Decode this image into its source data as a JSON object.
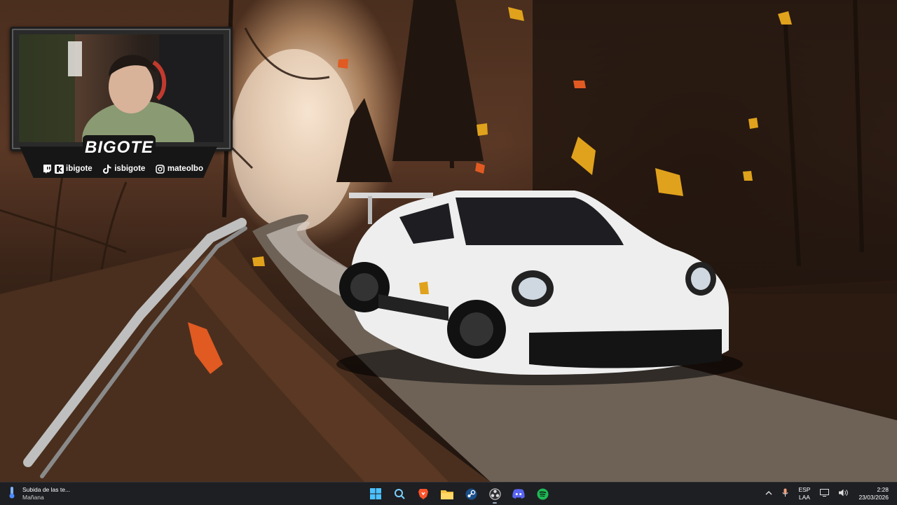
{
  "overlay": {
    "logo": "BIGOTE",
    "socials": [
      {
        "icon": "twitch-icon",
        "handle": "ibigote"
      },
      {
        "icon": "tiktok-icon",
        "handle": "isbigote"
      },
      {
        "icon": "instagram-icon",
        "handle": "mateolbo"
      }
    ]
  },
  "taskbar": {
    "weather": {
      "title": "Subida de las te...",
      "subtitle": "Mañana"
    },
    "apps": [
      "windows-start-icon",
      "search-icon",
      "brave-browser-icon",
      "file-explorer-icon",
      "steam-icon",
      "obs-icon",
      "discord-icon",
      "spotify-icon"
    ],
    "language": {
      "line1": "ESP",
      "line2": "LAA"
    },
    "clock": {
      "time": "2:28",
      "date": "23/03/2026"
    }
  },
  "colors": {
    "taskbar": "#1e1f23",
    "spotify": "#1db954",
    "discord": "#5865f2",
    "brave": "#fb542b",
    "explorer": "#f5c542"
  }
}
